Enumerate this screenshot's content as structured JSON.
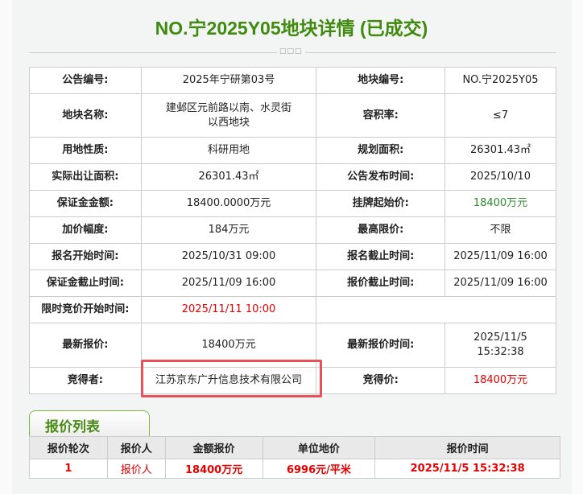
{
  "title": "NO.宁2025Y05地块详情 (已成交)",
  "divider": "□□□",
  "info": {
    "r0": [
      "公告编号:",
      "2025年宁研第03号",
      "地块编号:",
      "NO.宁2025Y05"
    ],
    "r1": [
      "地块名称:",
      "建邺区元前路以南、水灵街以西地块",
      "容积率:",
      "≤7"
    ],
    "r2": [
      "用地性质:",
      "科研用地",
      "规划面积:",
      "26301.43㎡"
    ],
    "r3": [
      "实际出让面积:",
      "26301.43㎡",
      "公告发布时间:",
      "2025/10/10"
    ],
    "r4": [
      "保证金金额:",
      "18400.0000万元",
      "挂牌起始价:",
      "18400万元"
    ],
    "r5": [
      "加价幅度:",
      "184万元",
      "最高限价:",
      "不限"
    ],
    "r6": [
      "报名开始时间:",
      "2025/10/31 09:00",
      "报名截止时间:",
      "2025/11/09 16:00"
    ],
    "r7": [
      "保证金截止时间:",
      "2025/11/09 16:00",
      "报价截止时间:",
      "2025/11/09 16:00"
    ],
    "r8": [
      "限时竞价开始时间:",
      "2025/11/11 10:00"
    ],
    "r9": [
      "最新报价:",
      "18400万元",
      "最新报价时间:",
      "2025/11/5 15:32:38"
    ],
    "r10": [
      "竞得者:",
      "江苏京东广升信息技术有限公司",
      "竞得价:",
      "18400万元"
    ]
  },
  "bid_tab": "报价列表",
  "bid_headers": [
    "报价轮次",
    "报价人",
    "金额报价",
    "单位地价",
    "报价时间"
  ],
  "bid_rows": [
    [
      "1",
      "报价人",
      "18400万元",
      "6996元/平米",
      "2025/11/5 15:32:38"
    ]
  ],
  "colors": {
    "title": "#3f8a0f",
    "highlight": "#e8505a",
    "red": "#e60000",
    "green": "#2d8a2d"
  }
}
